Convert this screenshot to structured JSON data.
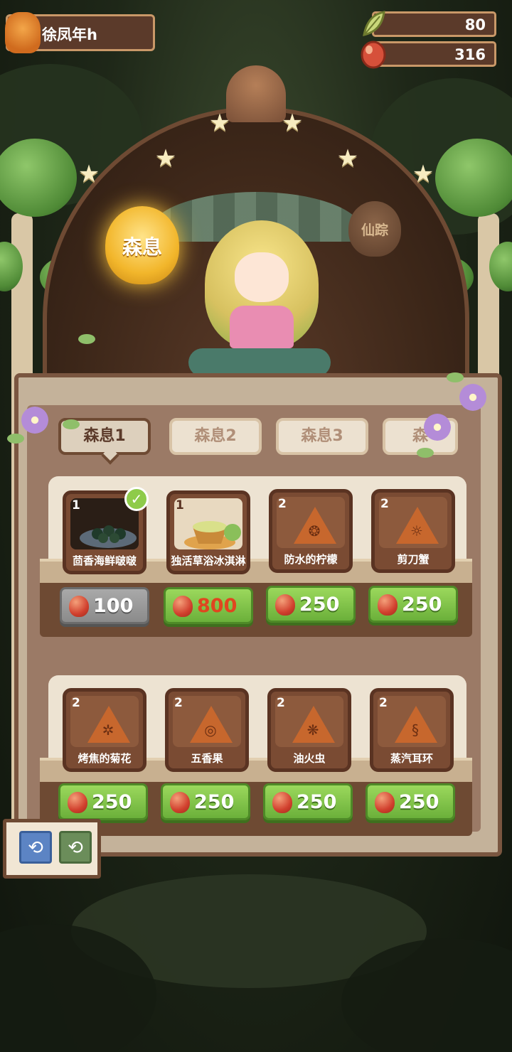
{
  "player": {
    "name": "徐凤年h"
  },
  "resources": {
    "leaves": "80",
    "eggs": "316"
  },
  "lanterns": {
    "active": "森息",
    "inactive": "仙踪"
  },
  "tabs": [
    {
      "label": "森息1",
      "active": true
    },
    {
      "label": "森息2",
      "active": false
    },
    {
      "label": "森息3",
      "active": false
    },
    {
      "label": "森",
      "active": false
    }
  ],
  "shelf1": [
    {
      "qty": "1",
      "name": "茴香海鲜啵啵",
      "price": "100",
      "state": "purchased"
    },
    {
      "qty": "1",
      "name": "独活草浴冰淇淋",
      "price": "800",
      "state": "highlight"
    },
    {
      "qty": "2",
      "name": "防水的柠檬",
      "price": "250",
      "state": "normal"
    },
    {
      "qty": "2",
      "name": "剪刀蟹",
      "price": "250",
      "state": "normal"
    }
  ],
  "shelf2": [
    {
      "qty": "2",
      "name": "烤焦的菊花",
      "price": "250",
      "state": "normal"
    },
    {
      "qty": "2",
      "name": "五香果",
      "price": "250",
      "state": "normal"
    },
    {
      "qty": "2",
      "name": "油火虫",
      "price": "250",
      "state": "normal"
    },
    {
      "qty": "2",
      "name": "蒸汽耳环",
      "price": "250",
      "state": "normal"
    }
  ],
  "icons": {
    "check": "✓",
    "star": "★",
    "switch": "⟲"
  },
  "colors": {
    "price_green": "#7fc24a",
    "price_grey": "#999999",
    "price_highlight_text": "#e0461f"
  }
}
